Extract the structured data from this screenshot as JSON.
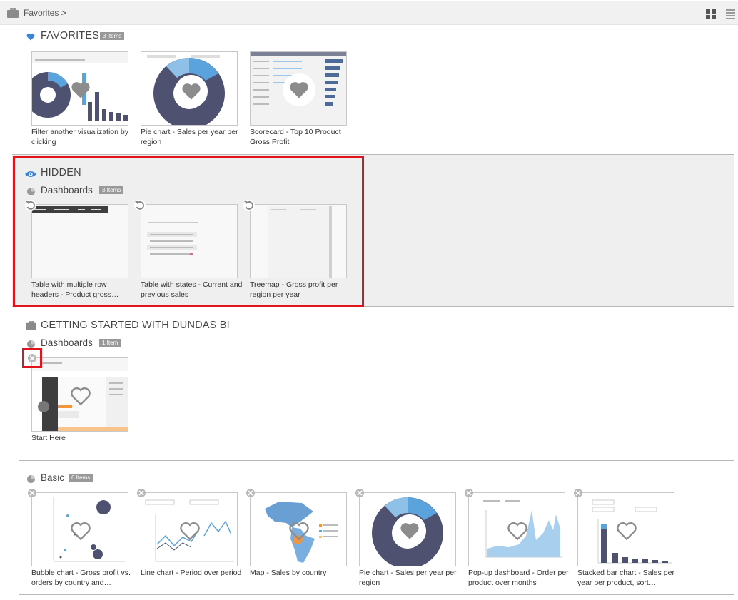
{
  "header": {
    "breadcrumb": "Favorites >",
    "tiles_icon": "grid-view-icon",
    "list_icon": "list-view-icon"
  },
  "favorites": {
    "title": "FAVORITES",
    "badge": "3 Items",
    "icon": "heart-icon",
    "items": [
      {
        "label": "Filter another visualization by clicking"
      },
      {
        "label": "Pie chart - Sales per year per region"
      },
      {
        "label": "Scorecard - Top 10 Product Gross Profit"
      }
    ]
  },
  "hidden": {
    "title": "HIDDEN",
    "icon": "eye-icon",
    "group_title": "Dashboards",
    "badge": "3 Items",
    "items": [
      {
        "label": "Table with multiple row headers - Product gross…"
      },
      {
        "label": "Table with states - Current and previous sales"
      },
      {
        "label": "Treemap - Gross profit per region per year"
      }
    ]
  },
  "getting_started": {
    "title": "GETTING STARTED WITH DUNDAS BI",
    "icon": "briefcase-icon",
    "group_title": "Dashboards",
    "badge": "1 Item",
    "items": [
      {
        "label": "Start Here"
      }
    ]
  },
  "basic": {
    "title": "Basic",
    "badge": "6 Items",
    "items": [
      {
        "label": "Bubble chart - Gross profit vs. orders by country and…"
      },
      {
        "label": "Line chart - Period over period"
      },
      {
        "label": "Map - Sales by country"
      },
      {
        "label": "Pie chart - Sales per year per region"
      },
      {
        "label": "Pop-up dashboard - Order per product over months"
      },
      {
        "label": "Stacked bar chart - Sales per year per product, sort…"
      }
    ]
  },
  "colors": {
    "accent_blue": "#3a86d6",
    "highlight_red": "#e2141b",
    "slate": "#4e5270",
    "badge_gray": "#999999"
  }
}
